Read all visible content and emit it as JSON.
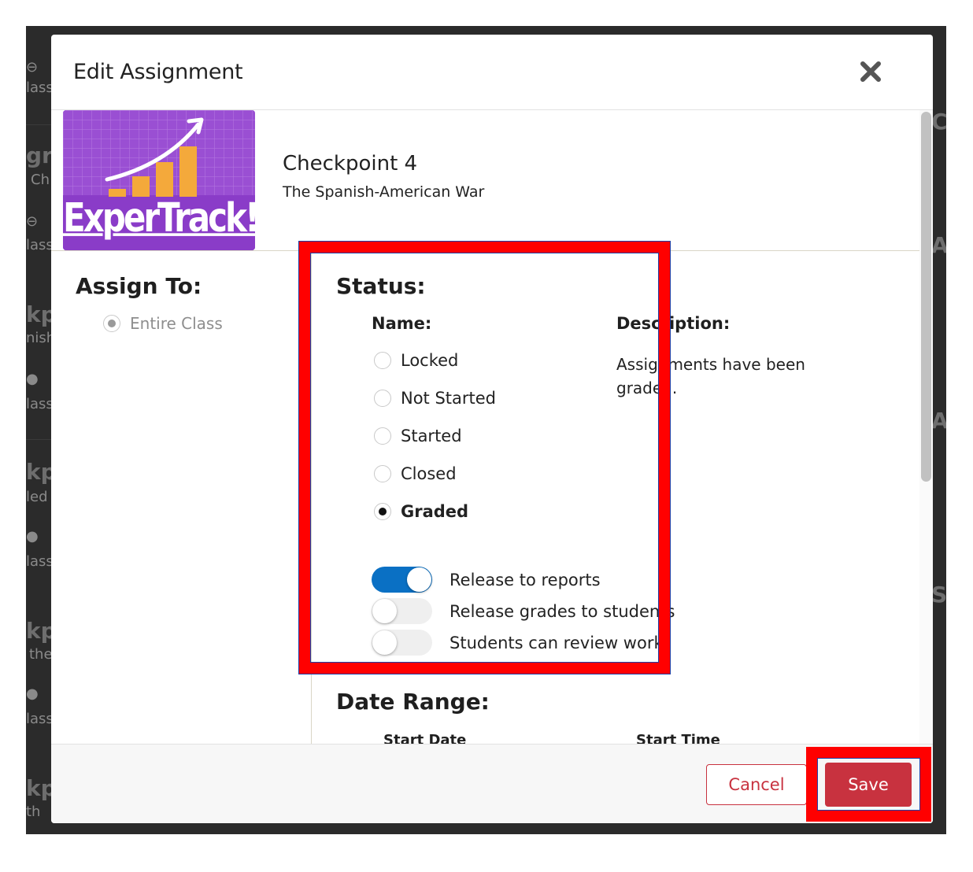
{
  "modal": {
    "title": "Edit Assignment"
  },
  "assignment": {
    "name": "Checkpoint 4",
    "subtitle": "The Spanish-American War",
    "thumbnail_text": "ExperTrack!"
  },
  "assign_to": {
    "heading": "Assign To:",
    "option": "Entire Class",
    "selected": true
  },
  "status": {
    "heading": "Status:",
    "name_header": "Name:",
    "description_header": "Description:",
    "options": [
      {
        "label": "Locked",
        "selected": false
      },
      {
        "label": "Not Started",
        "selected": false
      },
      {
        "label": "Started",
        "selected": false
      },
      {
        "label": "Closed",
        "selected": false
      },
      {
        "label": "Graded",
        "selected": true
      }
    ],
    "description": "Assignments have been graded."
  },
  "toggles": [
    {
      "label": "Release to reports",
      "on": true
    },
    {
      "label": "Release grades to students",
      "on": false
    },
    {
      "label": "Students can review work",
      "on": false
    }
  ],
  "date_range": {
    "heading": "Date Range:",
    "start_date_label": "Start Date",
    "start_time_label": "Start Time"
  },
  "footer": {
    "cancel_label": "Cancel",
    "save_label": "Save"
  },
  "colors": {
    "accent_red": "#c8323f",
    "toggle_on": "#0a70c4",
    "thumbnail_bg": "#9a4fd3",
    "highlight": "#ff0000"
  },
  "icons": {
    "close": "close-icon",
    "thumbnail": "growth-chart-icon"
  }
}
